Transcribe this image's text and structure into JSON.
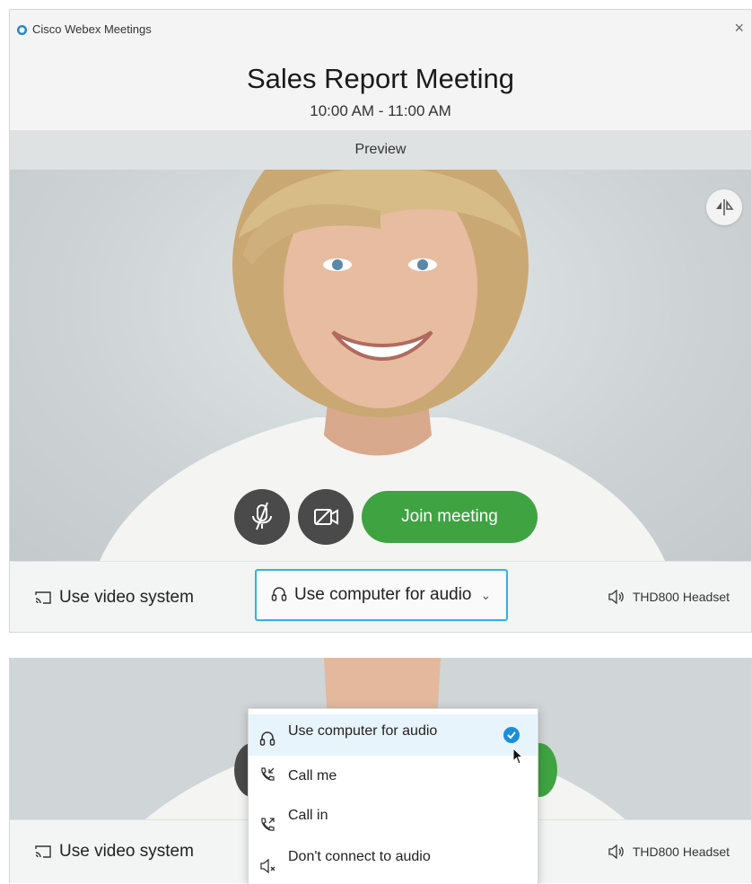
{
  "app": {
    "title": "Cisco Webex Meetings",
    "close_glyph": "×"
  },
  "meeting": {
    "title": "Sales Report Meeting",
    "time": "10:00 AM - 11:00 AM"
  },
  "preview": {
    "label": "Preview"
  },
  "controls": {
    "mute_icon": "mic-off-icon",
    "video_icon": "video-off-icon",
    "join_label": "Join meeting"
  },
  "bottom_bar": {
    "video_system_label": "Use video system",
    "audio_select_label": "Use computer for audio",
    "audio_select_chevron": "⌄",
    "headset_label": "THD800 Headset"
  },
  "dropdown": {
    "items": [
      {
        "label": "Use computer for audio",
        "icon": "headset-icon",
        "selected": true
      },
      {
        "label": "Call me",
        "icon": "phone-incoming-icon",
        "selected": false
      },
      {
        "label": "Call in",
        "icon": "phone-outgoing-icon",
        "selected": false
      },
      {
        "label": "Don't connect to audio",
        "icon": "speaker-mute-icon",
        "selected": false
      }
    ]
  },
  "colors": {
    "accent": "#35b2dc",
    "join_green": "#3fa342",
    "check_blue": "#1a8fd8",
    "control_dark": "#4a4a4a"
  }
}
